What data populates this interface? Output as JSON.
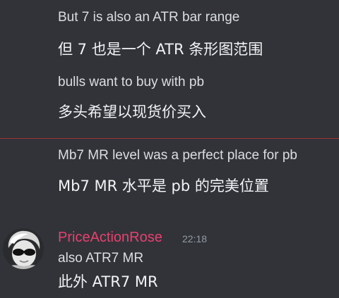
{
  "messages_top": [
    {
      "text": "But 7 is also an ATR bar range"
    },
    {
      "text": "但 7 也是一个 ATR 条形图范围"
    },
    {
      "text": "bulls want to buy with  pb"
    },
    {
      "text": "多头希望以现货价买入"
    }
  ],
  "new_messages_divider": {
    "color": "#a1323a"
  },
  "messages_after_divider": [
    {
      "text": "Mb7 MR level was a perfect place for pb"
    },
    {
      "text": "Mb7 MR 水平是 pb 的完美位置"
    }
  ],
  "message_group": {
    "author": "PriceActionRose",
    "author_color": "#e8406f",
    "timestamp": "22:18",
    "lines": [
      {
        "text": "also ATR7 MR"
      },
      {
        "text": "此外 ATR7 MR"
      }
    ]
  }
}
